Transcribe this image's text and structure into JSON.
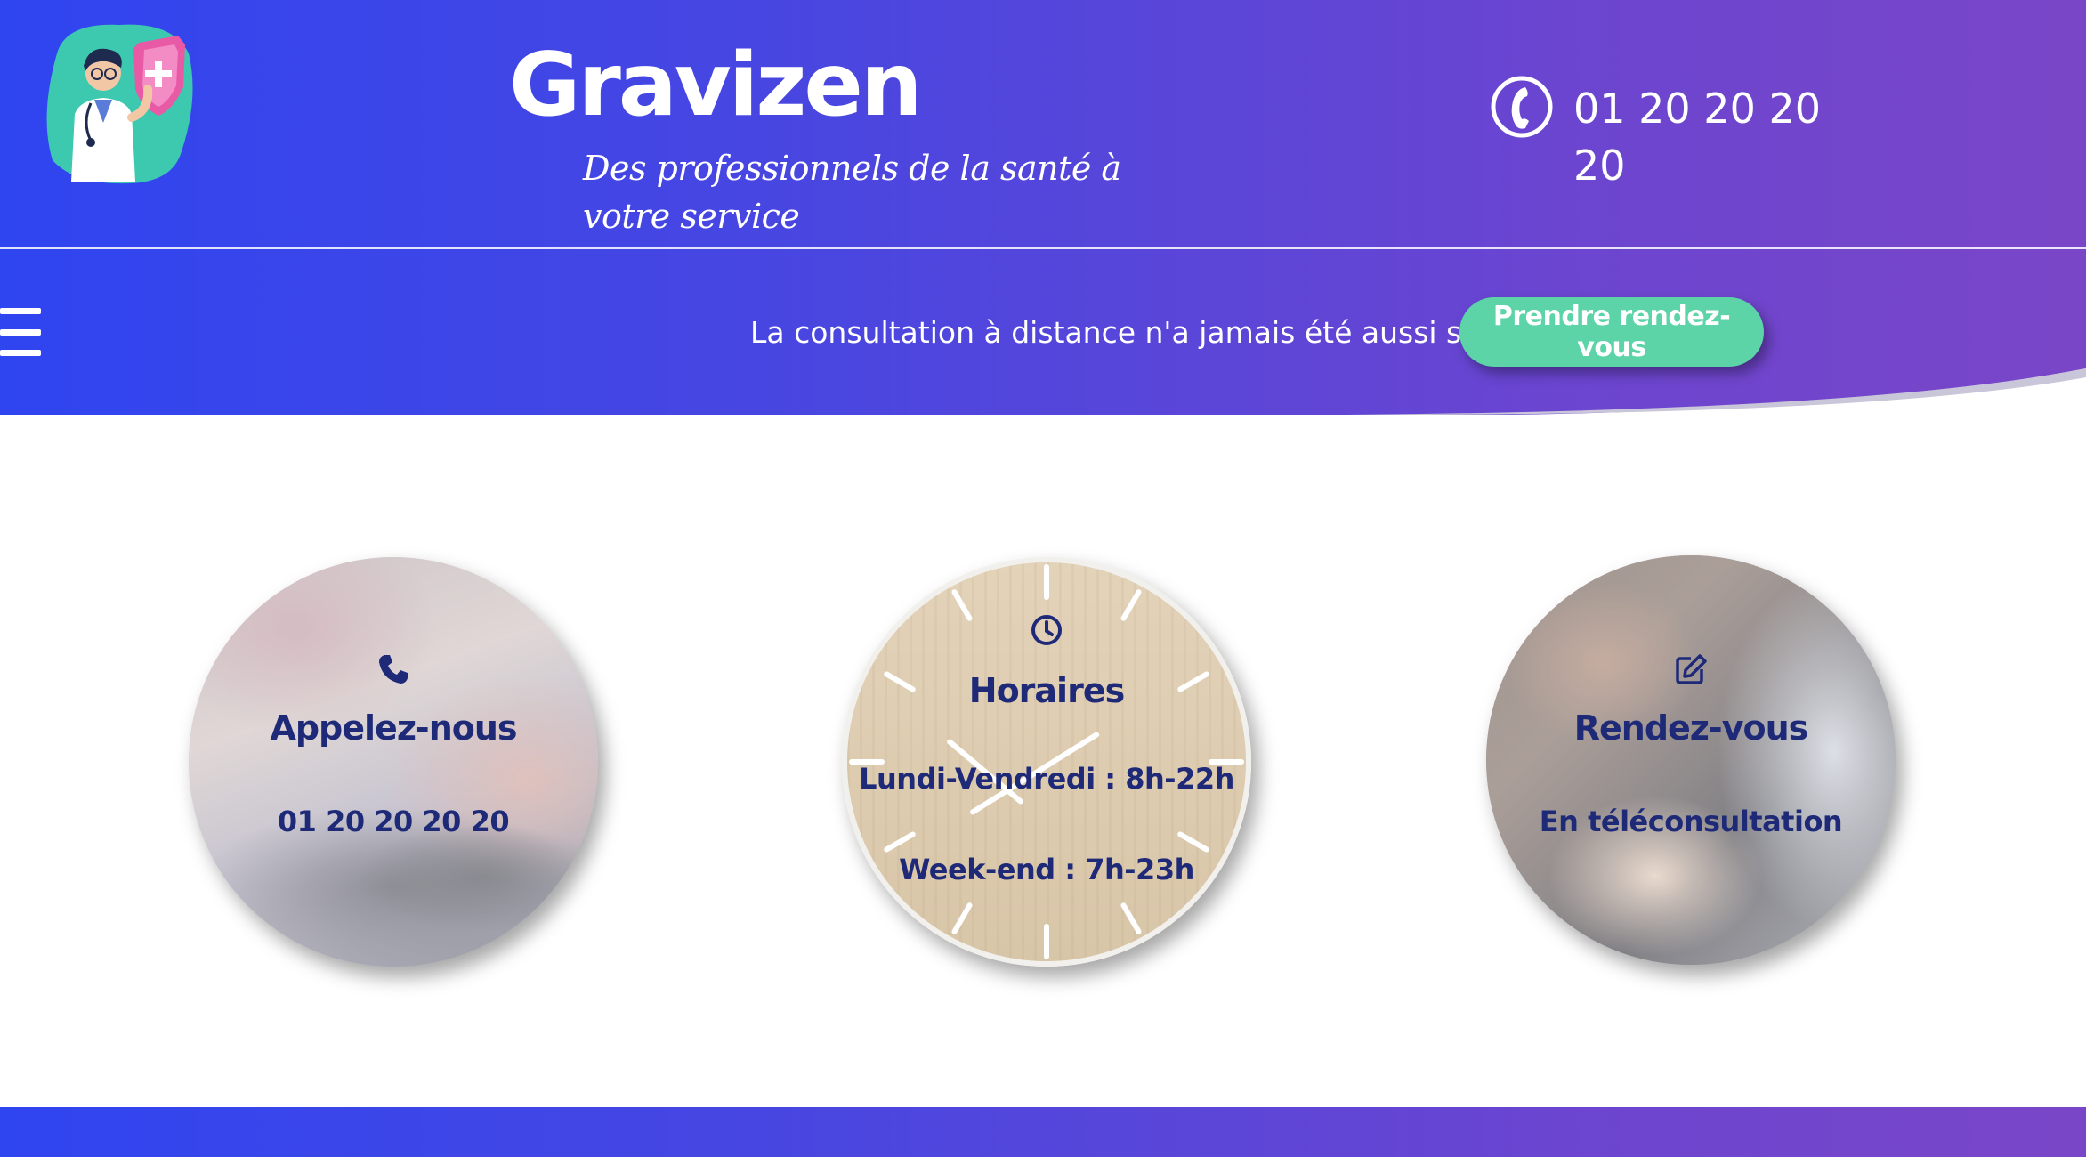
{
  "colors": {
    "gradient_start": "#2f45f0",
    "gradient_end": "#7a46c8",
    "cta_background": "#5dd3a8",
    "circle_text": "#1e2a78",
    "header_text": "#ffffff"
  },
  "header": {
    "logo_icon": "doctor-shield-illustration",
    "brand_name": "Gravizen",
    "tagline": "Des professionnels de la santé à votre service",
    "phone_icon": "phone-icon",
    "phone_number": "01 20 20 20 20"
  },
  "nav": {
    "menu_icon": "hamburger-menu-icon",
    "remote_text": "La consultation à distance n'a jamais été aussi simple :",
    "cta_label": "Prendre rendez-vous"
  },
  "cards": [
    {
      "icon": "phone-icon",
      "title": "Appelez-nous",
      "line1": "01 20 20 20 20"
    },
    {
      "icon": "clock-icon",
      "title": "Horaires",
      "line1": "Lundi-Vendredi : 8h-22h",
      "line2": "Week-end : 7h-23h"
    },
    {
      "icon": "edit-icon",
      "title": "Rendez-vous",
      "line1": "En téléconsultation"
    }
  ]
}
